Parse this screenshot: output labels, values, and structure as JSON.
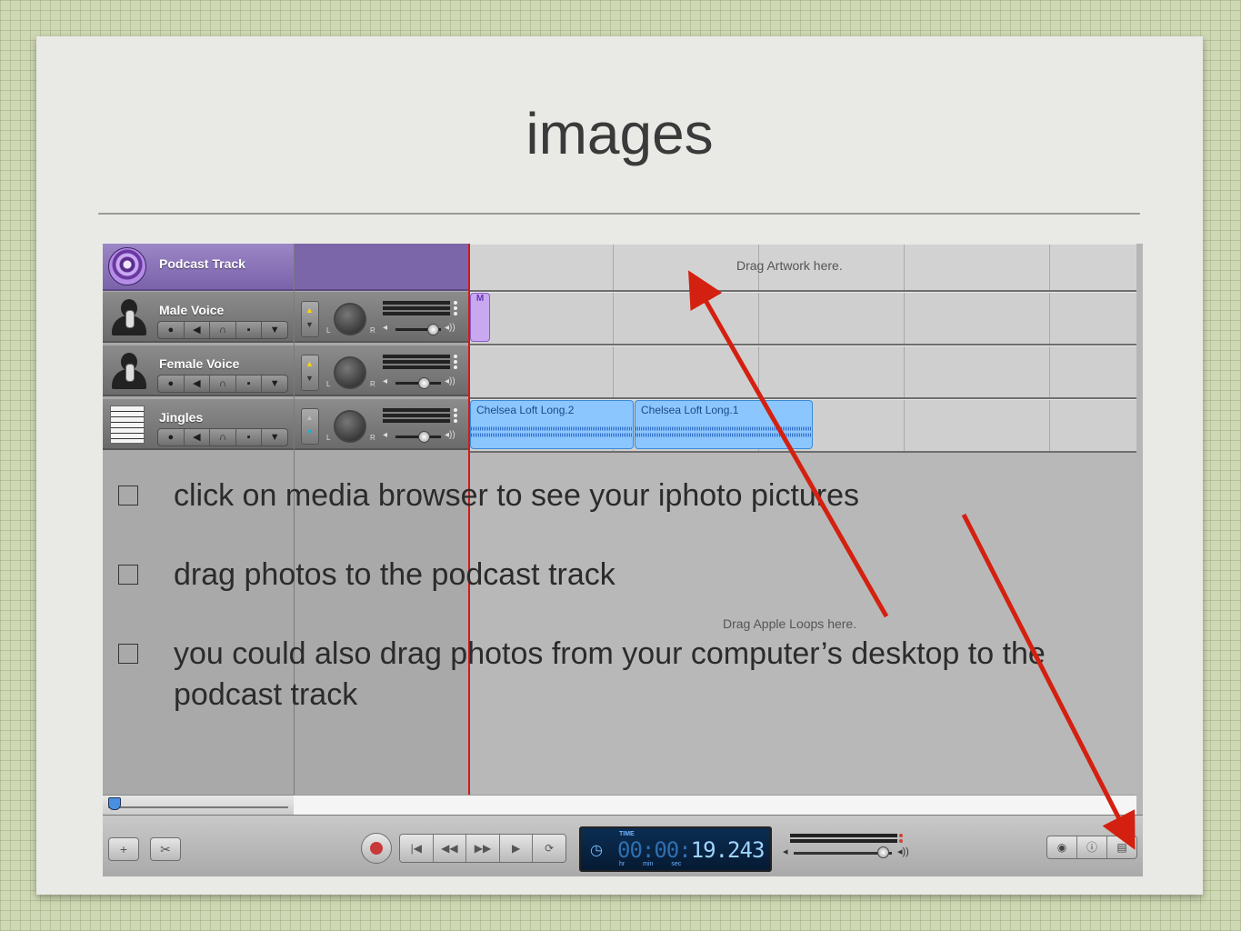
{
  "slide": {
    "title": "images",
    "bullets": [
      "click on media browser to see your iphoto pictures",
      "drag photos to  the podcast track",
      "you could also drag photos from your computer’s desktop to the podcast track"
    ]
  },
  "garageband": {
    "tracks": [
      {
        "name": "Podcast Track",
        "icon": "podcast-icon"
      },
      {
        "name": "Male Voice",
        "icon": "male-voice-icon",
        "volume": 0.8
      },
      {
        "name": "Female Voice",
        "icon": "female-voice-icon",
        "volume": 0.6
      },
      {
        "name": "Jingles",
        "icon": "sheet-music-icon",
        "volume": 0.6
      }
    ],
    "knob_left": "L",
    "knob_right": "R",
    "drag_artwork": "Drag Artwork here.",
    "drag_loops": "Drag Apple Loops here.",
    "marker_region": "M",
    "regions": [
      {
        "name": "Chelsea Loft Long.2"
      },
      {
        "name": "Chelsea Loft Long.1"
      }
    ],
    "lcd": {
      "time_label": "TIME",
      "digits_dim": "00:00:",
      "digits_lit": "19.243",
      "units": "hr min sec"
    },
    "master_volume": 0.9
  },
  "colors": {
    "arrow": "#d42010",
    "podcast_header": "#8a72b8",
    "region": "#8cc6ff",
    "playhead": "#d21a1a"
  }
}
